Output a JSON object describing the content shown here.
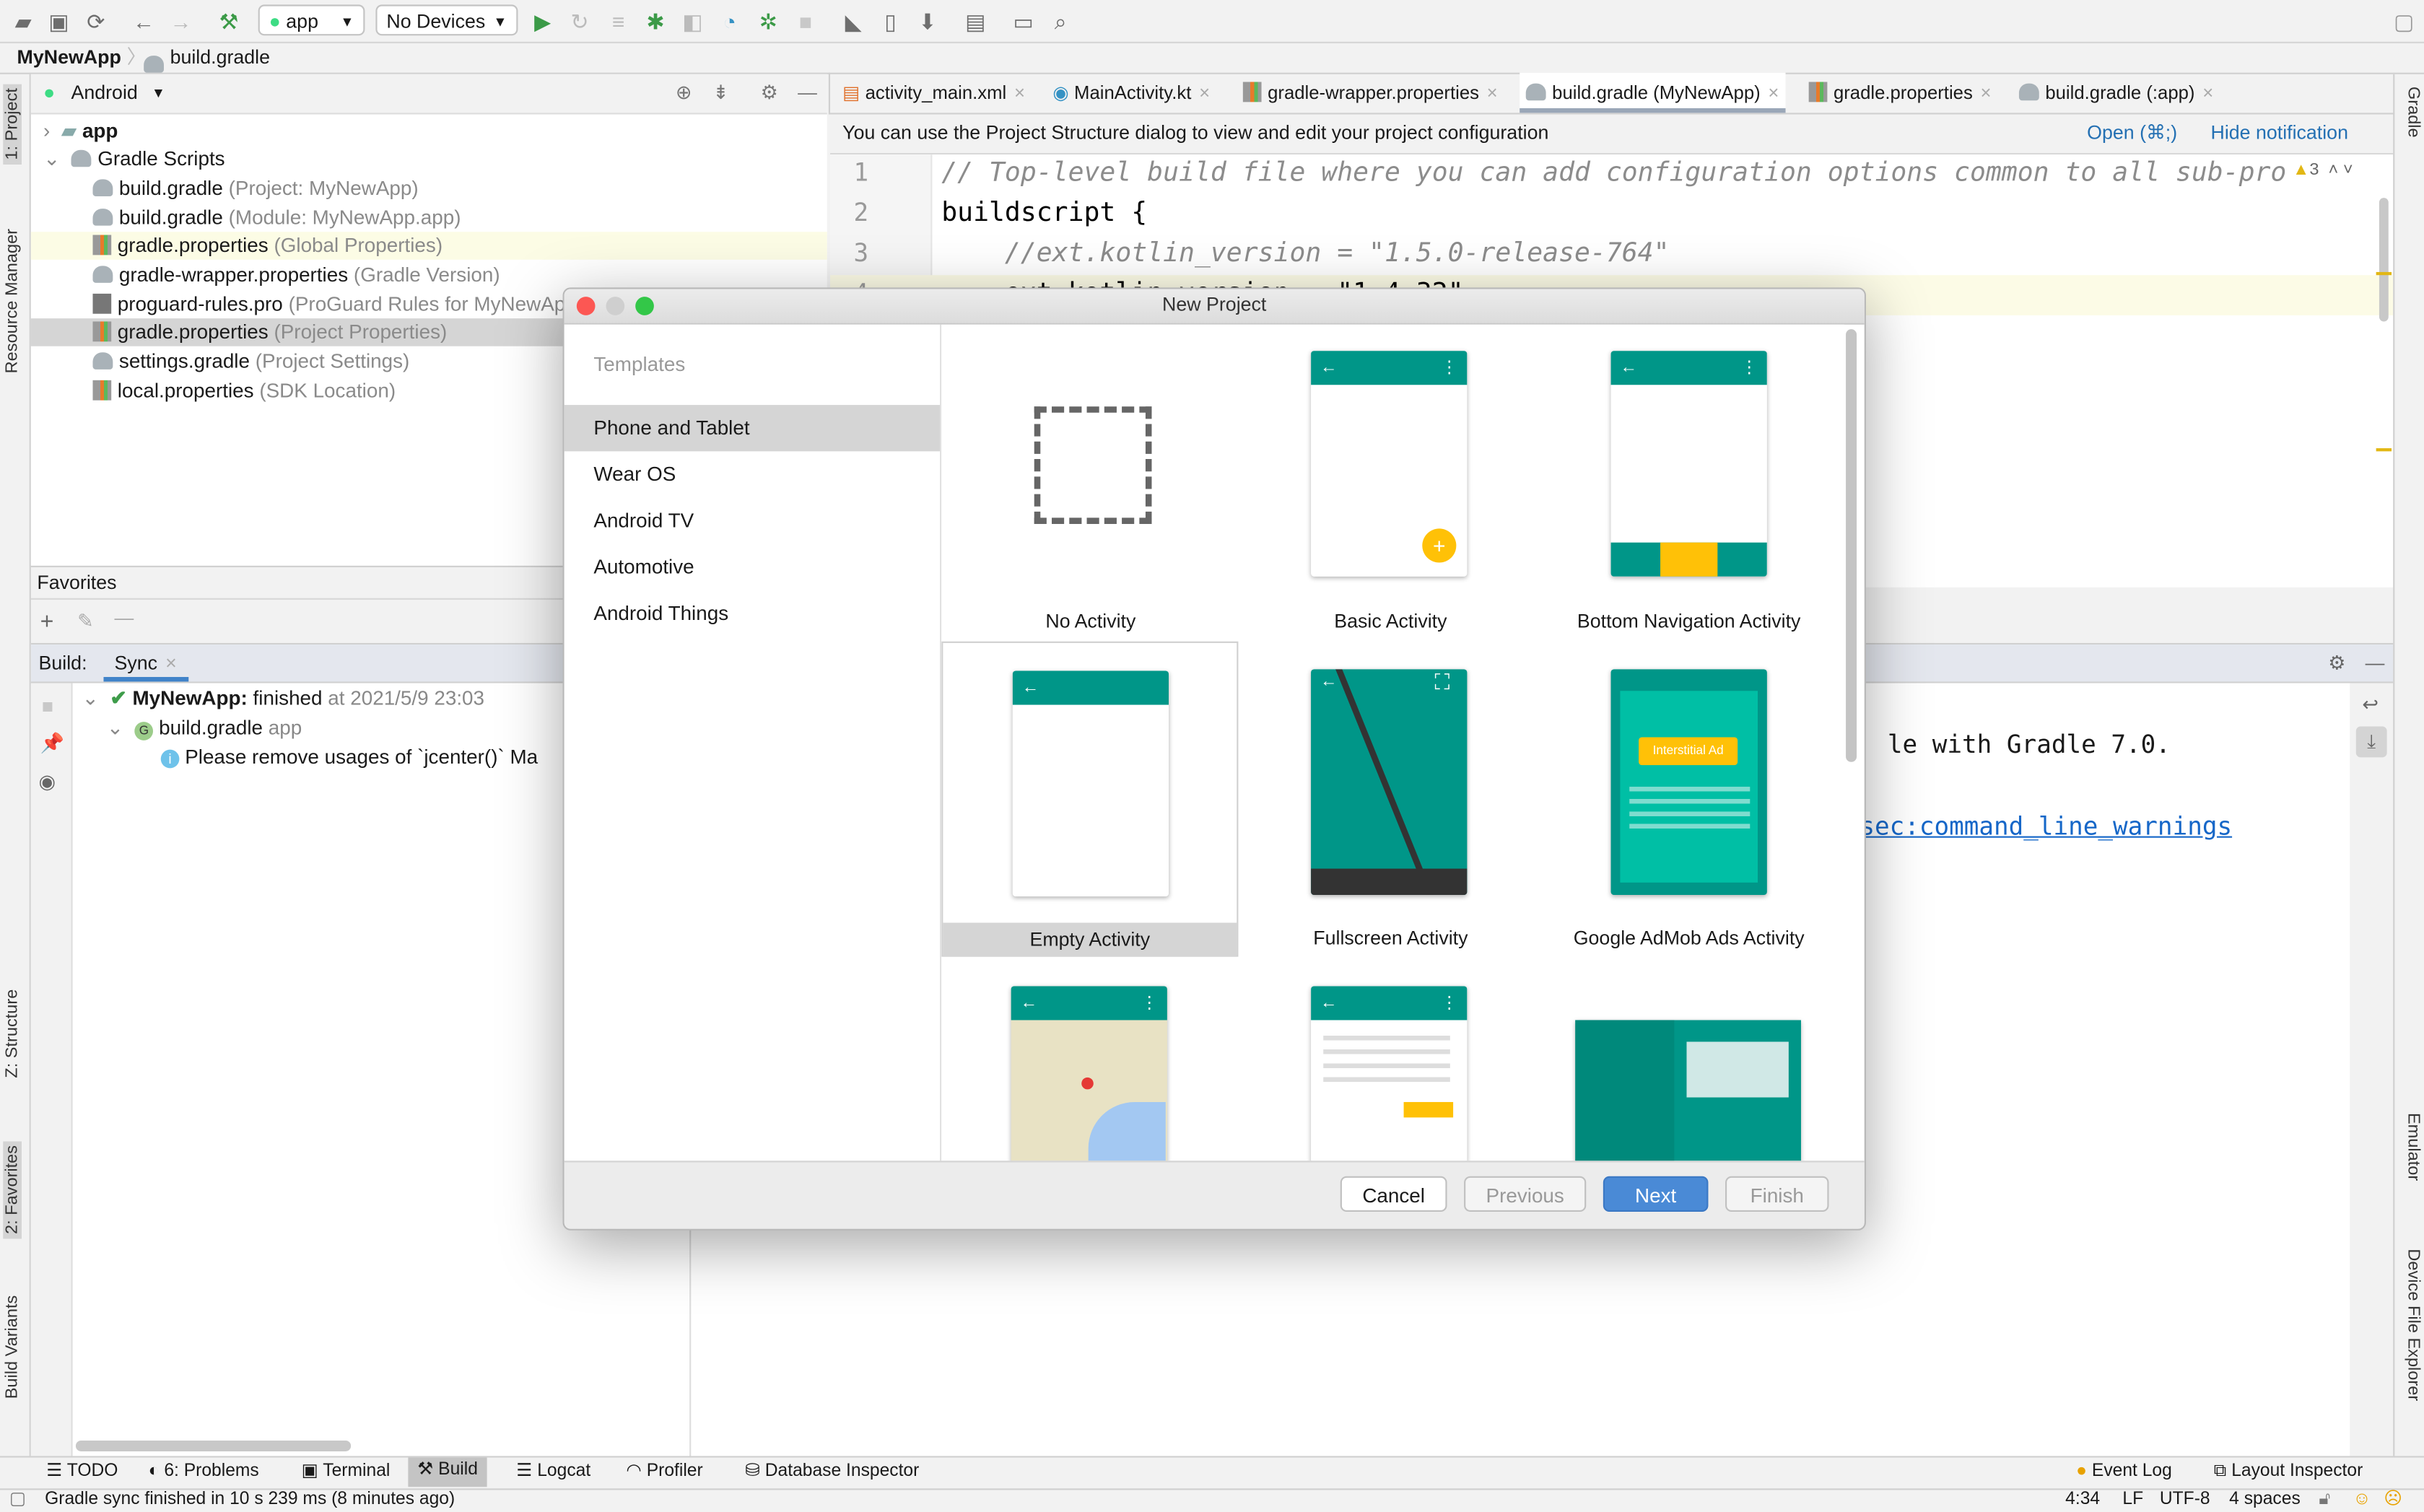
{
  "toolbar": {
    "config": "app",
    "device": "No Devices",
    "icons": [
      "open-folder-icon",
      "save-icon",
      "sync-icon",
      "back-icon",
      "forward-icon",
      "build-hammer-icon",
      "run-icon",
      "apply-changes-icon",
      "apply-code-changes-icon",
      "debug-icon",
      "attach-debugger-icon",
      "profile-icon",
      "run-with-coverage-icon",
      "stop-icon",
      "gradle-sync-icon",
      "avd-manager-icon",
      "sdk-manager-icon",
      "project-structure-icon",
      "running-devices-icon",
      "search-icon"
    ]
  },
  "breadcrumb": [
    "MyNewApp",
    "build.gradle"
  ],
  "left_stripe": [
    "1: Project",
    "Resource Manager",
    "Z: Structure",
    "2: Favorites",
    "Build Variants"
  ],
  "right_stripe": [
    "Gradle",
    "Emulator",
    "Device File Explorer"
  ],
  "project": {
    "view": "Android",
    "tree": [
      {
        "name": "app",
        "hint": ""
      },
      {
        "name": "Gradle Scripts",
        "hint": ""
      },
      {
        "name": "build.gradle",
        "hint": "(Project: MyNewApp)"
      },
      {
        "name": "build.gradle",
        "hint": "(Module: MyNewApp.app)"
      },
      {
        "name": "gradle.properties",
        "hint": "(Global Properties)"
      },
      {
        "name": "gradle-wrapper.properties",
        "hint": "(Gradle Version)"
      },
      {
        "name": "proguard-rules.pro",
        "hint": "(ProGuard Rules for MyNewApp.app)"
      },
      {
        "name": "gradle.properties",
        "hint": "(Project Properties)"
      },
      {
        "name": "settings.gradle",
        "hint": "(Project Settings)"
      },
      {
        "name": "local.properties",
        "hint": "(SDK Location)"
      }
    ],
    "favorites": "Favorites"
  },
  "editor": {
    "tabs": [
      "activity_main.xml",
      "MainActivity.kt",
      "gradle-wrapper.properties",
      "build.gradle (MyNewApp)",
      "gradle.properties",
      "build.gradle (:app)"
    ],
    "active_tab": 3,
    "notification": "You can use the Project Structure dialog to view and edit your project configuration",
    "notif_open": "Open (⌘;)",
    "notif_hide": "Hide notification",
    "warning_count": "3",
    "lines": [
      {
        "n": "1",
        "text": "// Top-level build file where you can add configuration options common to all sub-projects/modules."
      },
      {
        "n": "2",
        "text": "buildscript {"
      },
      {
        "n": "3",
        "text": "    //ext.kotlin_version = \"1.5.0-release-764\""
      },
      {
        "n": "4",
        "text": "    ext.kotlin_version = \"1.4.32\""
      }
    ]
  },
  "build": {
    "label": "Build:",
    "tab": "Sync",
    "tree": {
      "root_name": "MyNewApp:",
      "root_status": "finished",
      "root_time": "at 2021/5/9 23:03",
      "child": "build.gradle",
      "child_hint": "app",
      "message": "Please remove usages of `jcenter()` Ma"
    },
    "console_line1": "le with Gradle 7.0.",
    "console_link": "sec:command_line_warnings"
  },
  "bottom_tools": [
    "TODO",
    "6: Problems",
    "Terminal",
    "Build",
    "Logcat",
    "Profiler",
    "Database Inspector"
  ],
  "bottom_tools_right": [
    "Event Log",
    "Layout Inspector"
  ],
  "status": {
    "message": "Gradle sync finished in 10 s 239 ms (8 minutes ago)",
    "position": "4:34",
    "line_sep": "LF",
    "encoding": "UTF-8",
    "indent": "4 spaces"
  },
  "dialog": {
    "title": "New Project",
    "templates_header": "Templates",
    "categories": [
      "Phone and Tablet",
      "Wear OS",
      "Android TV",
      "Automotive",
      "Android Things"
    ],
    "selected_category": 0,
    "tiles": [
      "No Activity",
      "Basic Activity",
      "Bottom Navigation Activity",
      "Empty Activity",
      "Fullscreen Activity",
      "Google AdMob Ads Activity"
    ],
    "selected_tile": 3,
    "ad_label": "Interstitial Ad",
    "buttons": {
      "cancel": "Cancel",
      "previous": "Previous",
      "next": "Next",
      "finish": "Finish"
    },
    "colors": {
      "teal": "#009688",
      "accent": "#ffc107",
      "next": "#4a8ad6"
    }
  }
}
